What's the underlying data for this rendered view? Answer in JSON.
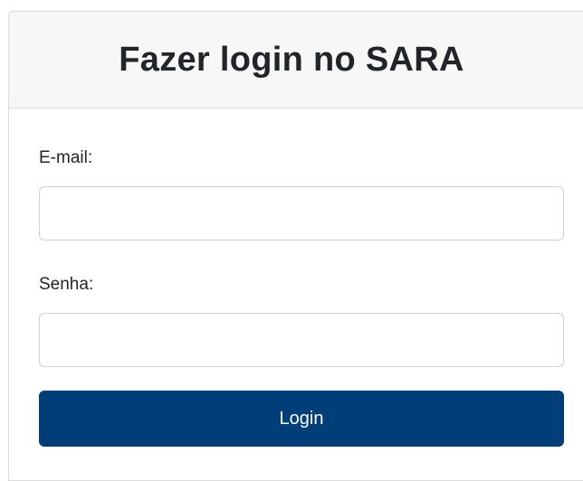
{
  "login_form": {
    "title": "Fazer login no SARA",
    "email_label": "E-mail:",
    "email_value": "",
    "email_placeholder": "",
    "password_label": "Senha:",
    "password_value": "",
    "password_placeholder": "",
    "submit_label": "Login"
  },
  "colors": {
    "header_background": "#f7f7f7",
    "button_background": "#003e7a",
    "button_text": "#ffffff",
    "border": "#dcdcdc"
  }
}
